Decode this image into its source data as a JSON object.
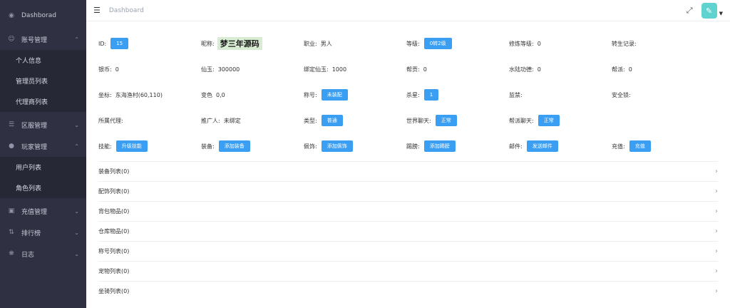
{
  "sidebar": {
    "items": [
      {
        "label": "Dashborad",
        "icon": "dashboard-icon",
        "chev": false
      },
      {
        "label": "账号管理",
        "icon": "users-icon",
        "chev": true,
        "open": true,
        "children": [
          "个人信息",
          "管理员列表",
          "代理商列表"
        ]
      },
      {
        "label": "区服管理",
        "icon": "server-icon",
        "chev": true
      },
      {
        "label": "玩家管理",
        "icon": "gamepad-icon",
        "chev": true,
        "open": true,
        "children": [
          "用户列表",
          "角色列表"
        ]
      },
      {
        "label": "充值管理",
        "icon": "wallet-icon",
        "chev": true
      },
      {
        "label": "排行榜",
        "icon": "rank-icon",
        "chev": true
      },
      {
        "label": "日志",
        "icon": "bug-icon",
        "chev": true
      }
    ]
  },
  "topbar": {
    "breadcrumb": "Dashboard"
  },
  "info": {
    "row1": {
      "id_label": "ID:",
      "id_value": "15",
      "nick_label": "昵称:",
      "nick_value": "梦三年源码",
      "job_label": "职业:",
      "job_value": "男人",
      "level_label": "等级:",
      "level_btn": "0转2级",
      "cult_label": "修炼等级:",
      "cult_value": "0",
      "rebirth_label": "转生记录:"
    },
    "row2": {
      "silver_label": "银币:",
      "silver_value": "0",
      "jade_label": "仙玉:",
      "jade_value": "300000",
      "bjade_label": "绑定仙玉:",
      "bjade_value": "1000",
      "contrib_label": "帮贡:",
      "contrib_value": "0",
      "merit_label": "水陆功德:",
      "merit_value": "0",
      "guild_label": "帮派:",
      "guild_value": "0"
    },
    "row3": {
      "coord_label": "坐标:",
      "coord_value": "东海渔村(60,110)",
      "color_label": "变色",
      "color_value": "0,0",
      "title_label": "称号:",
      "title_btn": "未装配",
      "star_label": "杀星:",
      "star_btn": "1",
      "jail_label": "监禁:",
      "lock_label": "安全锁:"
    },
    "row4": {
      "agent_label": "所属代理:",
      "promoter_label": "推广人:",
      "promoter_value": "未绑定",
      "type_label": "类型:",
      "type_btn": "普通",
      "world_label": "世界聊天:",
      "world_btn": "正常",
      "gchat_label": "帮派聊天:",
      "gchat_btn": "正常"
    },
    "row5": {
      "skill_label": "技能:",
      "skill_btn": "升级技能",
      "equip_label": "装备:",
      "equip_btn": "添加装备",
      "orn_label": "佩饰:",
      "orn_btn": "添加佩饰",
      "mount_label": "踢膀:",
      "mount_btn": "添加踢膀",
      "mail_label": "邮件:",
      "mail_btn": "发送邮件",
      "charge_label": "充值:",
      "charge_btn": "充值"
    }
  },
  "lists": [
    "装备列表(0)",
    "配饰列表(0)",
    "背包物品(0)",
    "仓库物品(0)",
    "称号列表(0)",
    "宠物列表(0)",
    "坐骑列表(0)"
  ],
  "colors": {
    "sidebar_bg": "#2f3142",
    "accent": "#3a9ef3",
    "avatar": "#5fd3cf"
  }
}
